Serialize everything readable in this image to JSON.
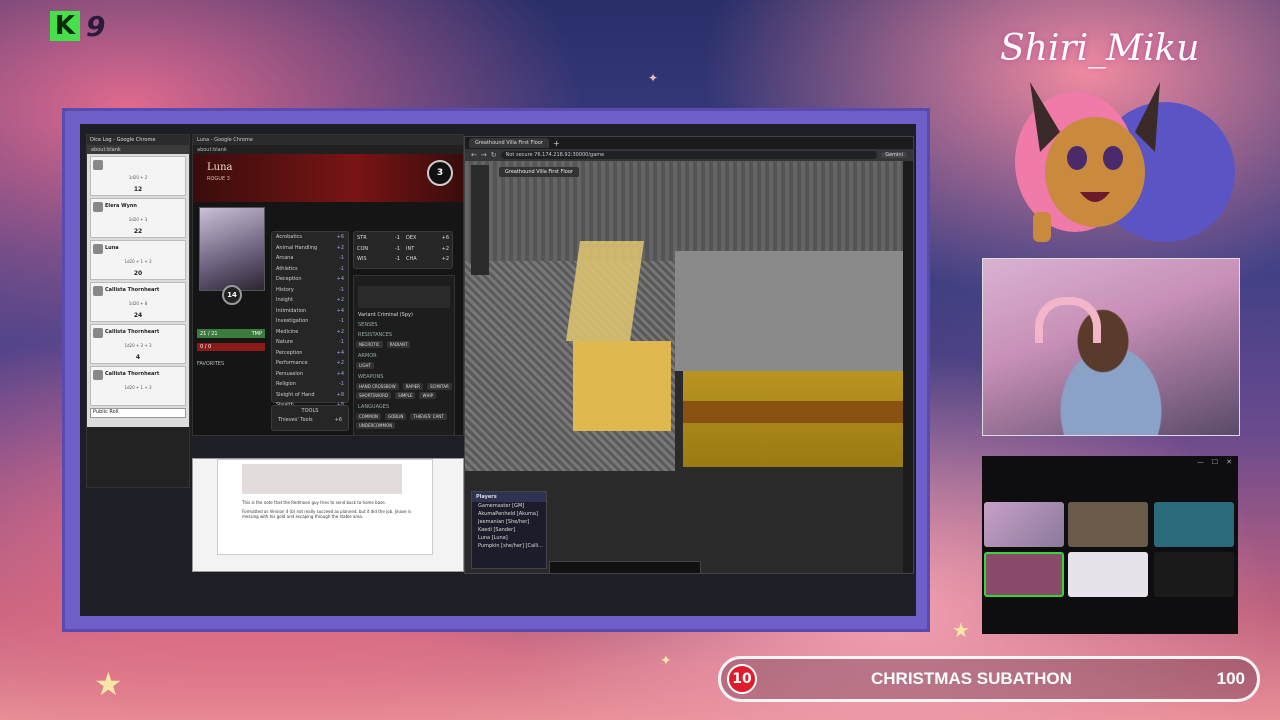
{
  "overlay": {
    "logo_letter": "K",
    "logo_number": "9",
    "streamer_signature": "Shiri_Miku",
    "subathon": {
      "count": "10",
      "title": "CHRISTMAS SUBATHON",
      "goal": "100"
    }
  },
  "left_window": {
    "tab_title": "Dice Log - Google Chrome",
    "address": "about:blank",
    "cards": [
      {
        "name": "",
        "roll": "1d20 + 2",
        "value": "12"
      },
      {
        "name": "Elera Wynn",
        "roll": "1d20 + 3",
        "value": "22"
      },
      {
        "name": "Luna",
        "roll": "1d20 + 1 + 3",
        "value": "20"
      },
      {
        "name": "Callista Thornheart",
        "roll": "1d20 + 8",
        "value": "24"
      },
      {
        "name": "Callista Thornheart",
        "roll": "1d20 + 2 + 3",
        "value": "4"
      },
      {
        "name": "Callista Thornheart",
        "roll": "1d20 + 1 + 3",
        "value": ""
      }
    ],
    "footer_select": "Public Roll"
  },
  "sheet_window": {
    "tab_title": "Luna - Google Chrome",
    "address": "about:blank",
    "character_name": "Luna",
    "class_line": "ROGUE 3",
    "level": "3",
    "portrait_badge": "14",
    "hp_label": "21 / 21",
    "hp_temp": "TMP",
    "death": "0 / 0",
    "favorites": "FAVORITES",
    "skills": [
      {
        "label": "Acrobatics",
        "mod": "+6"
      },
      {
        "label": "Animal Handling",
        "mod": "+2"
      },
      {
        "label": "Arcana",
        "mod": "-1"
      },
      {
        "label": "Athletics",
        "mod": "-1"
      },
      {
        "label": "Deception",
        "mod": "+4"
      },
      {
        "label": "History",
        "mod": "-1"
      },
      {
        "label": "Insight",
        "mod": "+2"
      },
      {
        "label": "Intimidation",
        "mod": "+4"
      },
      {
        "label": "Investigation",
        "mod": "-1"
      },
      {
        "label": "Medicine",
        "mod": "+2"
      },
      {
        "label": "Nature",
        "mod": "-1"
      },
      {
        "label": "Perception",
        "mod": "+4"
      },
      {
        "label": "Performance",
        "mod": "+2"
      },
      {
        "label": "Persuasion",
        "mod": "+4"
      },
      {
        "label": "Religion",
        "mod": "-1"
      },
      {
        "label": "Sleight of Hand",
        "mod": "+8"
      },
      {
        "label": "Stealth",
        "mod": "+8"
      },
      {
        "label": "Survival",
        "mod": "+2"
      }
    ],
    "tools_header": "TOOLS",
    "tool": "Thieves' Tools",
    "tool_mod": "+6",
    "stats": [
      {
        "label": "STR",
        "val": "-1"
      },
      {
        "label": "DEX",
        "val": "+6"
      },
      {
        "label": "CON",
        "val": "-1"
      },
      {
        "label": "INT",
        "val": "+2"
      },
      {
        "label": "WIS",
        "val": "-1"
      },
      {
        "label": "CHA",
        "val": "+2"
      }
    ],
    "background": "Variant Criminal (Spy)",
    "sections": {
      "senses": "SENSES",
      "resistances": "RESISTANCES",
      "armor": "ARMOR",
      "weapons": "WEAPONS",
      "languages": "LANGUAGES"
    },
    "resistances_chips": [
      "NECROTIC",
      "RADIANT"
    ],
    "armor_chips": [
      "LIGHT"
    ],
    "weapon_chips": [
      "HAND CROSSBOW",
      "RAPIER",
      "SCIMITAR",
      "SHORTSWORD",
      "SIMPLE",
      "WHIP"
    ],
    "language_chips": [
      "COMMON",
      "GOBLIN",
      "THIEVES' CANT",
      "UNDERCOMMON"
    ]
  },
  "doc_window": {
    "line1": "This is the note that the Redmoon guy tries to send back to home base.",
    "line2": "Formatted as Version 4 (b) not really succeed as planned, but it did the job. Jinaxe is messing with his gold and escaping through the stable area."
  },
  "map_window": {
    "tab_title": "Greathound Villa First Floor",
    "url": "Not secure  76.174.218.92:30000/game",
    "scene_title": "Greathound Villa First Floor",
    "assistant": "Gemini",
    "players_header": "Players",
    "players": [
      "Gamemaster [GM]",
      "AkumaPenheld [Akuma]",
      "Jeemanian [She/her]",
      "Kaedi [Sander]",
      "Luna [Luna]",
      "Pumpkin [she/her] [Calli..."
    ]
  },
  "colors": {
    "frame": "#6e5fc9",
    "subathon_badge": "#e01c2c",
    "hp_green": "#3b7b3b"
  }
}
